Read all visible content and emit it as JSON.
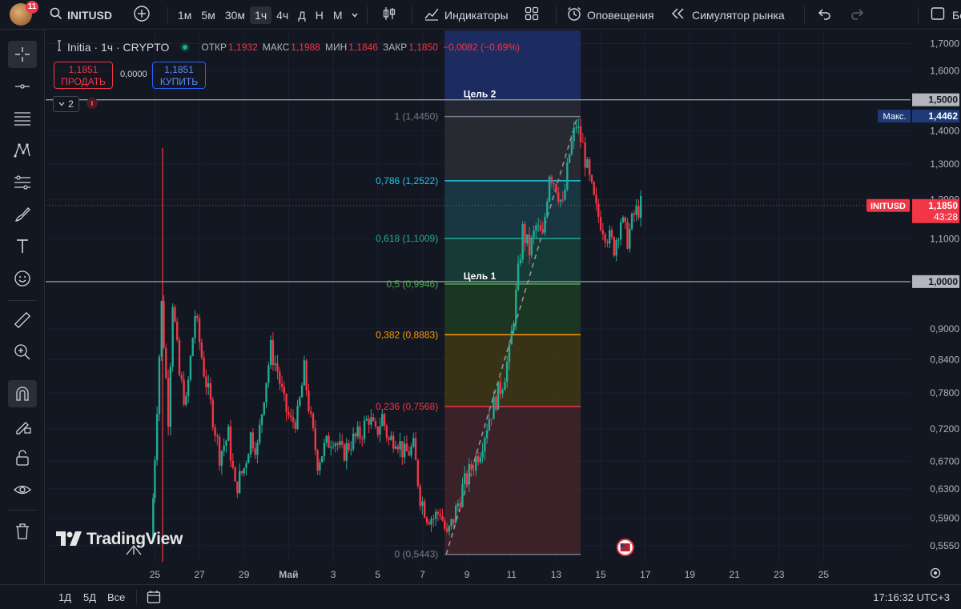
{
  "header": {
    "notif_count": "11",
    "symbol": "INITUSD",
    "intervals": [
      "1м",
      "5м",
      "30м",
      "1ч",
      "4ч",
      "Д",
      "Н",
      "М"
    ],
    "active_interval": "1ч",
    "indicators": "Индикаторы",
    "alerts": "Оповещения",
    "replay": "Симулятор рынка",
    "cut": "Бе"
  },
  "legend": {
    "title": "Initia · 1ч · CRYPTO",
    "open_label": "ОТКР",
    "open": "1,1932",
    "high_label": "МАКС",
    "high": "1,1988",
    "low_label": "МИН",
    "low": "1,1846",
    "close_label": "ЗАКР",
    "close": "1,1850",
    "change": "−0,0082 (−0,69%)"
  },
  "trade": {
    "sell_price": "1,1851",
    "sell_label": "ПРОДАТЬ",
    "spread": "0,0000",
    "buy_price": "1,1851",
    "buy_label": "КУПИТЬ"
  },
  "indicator_count": "2",
  "watermark": "TradingView",
  "chart_data": {
    "type": "candlestick",
    "symbol": "INITUSD",
    "ylim": [
      0.545,
      1.72
    ],
    "y_scale": "log",
    "y_ticks": [
      "1,7000",
      "1,6000",
      "1,4000",
      "1,3000",
      "1,2000",
      "1,1000",
      "0,9000",
      "0,8400",
      "0,7800",
      "0,7200",
      "0,6700",
      "0,6300",
      "0,5900",
      "0,5550"
    ],
    "x_ticks": [
      "25",
      "27",
      "29",
      "Май",
      "3",
      "5",
      "7",
      "9",
      "11",
      "13",
      "15",
      "17",
      "19",
      "21",
      "23",
      "25"
    ],
    "x_tick_days": [
      25,
      27,
      29,
      31,
      33,
      35,
      37,
      39,
      41,
      43,
      45,
      47,
      49,
      51,
      53,
      55
    ],
    "xlim_days": [
      20.1,
      58.9
    ],
    "last_price": 1.185,
    "last_price_label": "1,1850",
    "countdown": "43:28",
    "ticker_tag": "INITUSD",
    "max_value": "1,4462",
    "max_label": "Макс.",
    "horizontal_lines": [
      {
        "label": "Цель 2",
        "price": 1.5,
        "price_label": "1,5000"
      },
      {
        "label": "Цель 1",
        "price": 1.0,
        "price_label": "1,0000"
      }
    ],
    "fib": {
      "start_day": 38.0,
      "end_day": 44.1,
      "levels": [
        {
          "label": "1 (1,4450)",
          "price": 1.445,
          "color": "#787b86"
        },
        {
          "label": "0,786 (1,2522)",
          "price": 1.2522,
          "color": "#22c3e6"
        },
        {
          "label": "0,618 (1,1009)",
          "price": 1.1009,
          "color": "#22ab94"
        },
        {
          "label": "0,5 (0,9946)",
          "price": 0.9946,
          "color": "#4caf50"
        },
        {
          "label": "0,382 (0,8883)",
          "price": 0.8883,
          "color": "#ff9800"
        },
        {
          "label": "0,236 (0,7568)",
          "price": 0.7568,
          "color": "#f23645"
        },
        {
          "label": "0 (0,5443)",
          "price": 0.5443,
          "color": "#787b86"
        }
      ]
    },
    "path": [
      [
        24.85,
        0.56
      ],
      [
        25.0,
        0.68
      ],
      [
        25.3,
        0.95
      ],
      [
        25.6,
        0.74
      ],
      [
        25.8,
        0.96
      ],
      [
        26.1,
        0.81
      ],
      [
        26.4,
        0.76
      ],
      [
        26.8,
        0.93
      ],
      [
        27.2,
        0.82
      ],
      [
        27.6,
        0.74
      ],
      [
        27.9,
        0.68
      ],
      [
        28.3,
        0.71
      ],
      [
        28.6,
        0.63
      ],
      [
        29.0,
        0.66
      ],
      [
        29.3,
        0.71
      ],
      [
        29.6,
        0.69
      ],
      [
        29.9,
        0.78
      ],
      [
        30.2,
        0.86
      ],
      [
        30.5,
        0.82
      ],
      [
        30.8,
        0.76
      ],
      [
        31.1,
        0.73
      ],
      [
        31.4,
        0.74
      ],
      [
        31.7,
        0.82
      ],
      [
        32.0,
        0.73
      ],
      [
        32.3,
        0.67
      ],
      [
        32.6,
        0.69
      ],
      [
        33.0,
        0.71
      ],
      [
        33.4,
        0.68
      ],
      [
        33.8,
        0.7
      ],
      [
        34.2,
        0.71
      ],
      [
        34.6,
        0.74
      ],
      [
        34.9,
        0.71
      ],
      [
        35.2,
        0.74
      ],
      [
        35.5,
        0.7
      ],
      [
        35.8,
        0.71
      ],
      [
        36.2,
        0.68
      ],
      [
        36.6,
        0.69
      ],
      [
        36.9,
        0.62
      ],
      [
        37.2,
        0.595
      ],
      [
        37.5,
        0.59
      ],
      [
        37.8,
        0.6
      ],
      [
        38.1,
        0.565
      ],
      [
        38.4,
        0.59
      ],
      [
        38.8,
        0.63
      ],
      [
        39.2,
        0.66
      ],
      [
        39.6,
        0.69
      ],
      [
        40.0,
        0.74
      ],
      [
        40.3,
        0.77
      ],
      [
        40.6,
        0.8
      ],
      [
        40.9,
        0.85
      ],
      [
        41.2,
        0.97
      ],
      [
        41.5,
        1.12
      ],
      [
        41.8,
        1.07
      ],
      [
        42.1,
        1.13
      ],
      [
        42.4,
        1.1
      ],
      [
        42.7,
        1.28
      ],
      [
        43.0,
        1.24
      ],
      [
        43.3,
        1.18
      ],
      [
        43.6,
        1.33
      ],
      [
        43.9,
        1.42
      ],
      [
        44.2,
        1.35
      ],
      [
        44.5,
        1.25
      ],
      [
        44.8,
        1.17
      ],
      [
        45.2,
        1.12
      ],
      [
        45.6,
        1.08
      ],
      [
        45.9,
        1.15
      ],
      [
        46.2,
        1.1
      ],
      [
        46.5,
        1.16
      ],
      [
        46.8,
        1.185
      ]
    ]
  },
  "bottom": {
    "ranges": [
      "1Д",
      "5Д",
      "Все"
    ],
    "time": "17:16:32 UTC+3"
  }
}
